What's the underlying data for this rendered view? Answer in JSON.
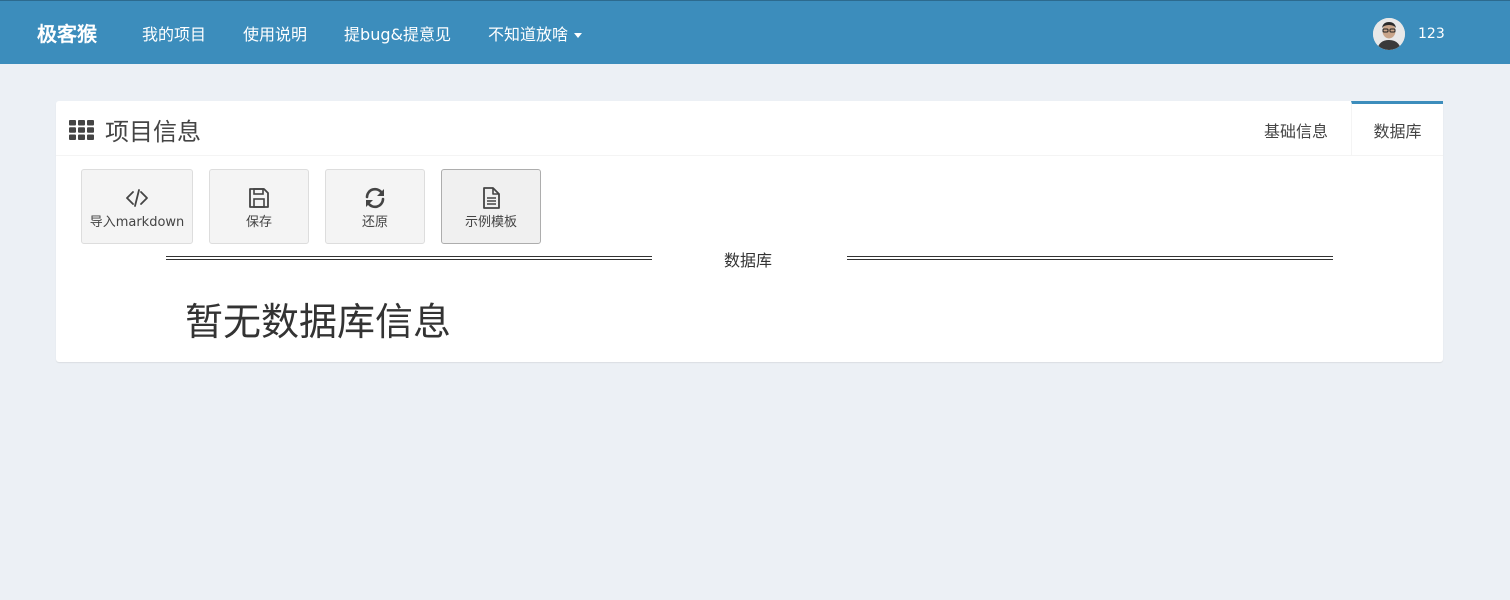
{
  "navbar": {
    "brand": "极客猴",
    "links": [
      {
        "label": "我的项目"
      },
      {
        "label": "使用说明"
      },
      {
        "label": "提bug&提意见"
      },
      {
        "label": "不知道放啥",
        "has_dropdown": true
      }
    ],
    "user": {
      "name": "123"
    }
  },
  "panel": {
    "title": "项目信息",
    "title_icon": "th-grid-icon",
    "tabs": [
      {
        "label": "基础信息",
        "active": false
      },
      {
        "label": "数据库",
        "active": true
      }
    ],
    "toolbar": [
      {
        "label": "导入markdown",
        "icon": "code-icon"
      },
      {
        "label": "保存",
        "icon": "save-icon"
      },
      {
        "label": "还原",
        "icon": "refresh-icon"
      },
      {
        "label": "示例模板",
        "icon": "file-text-icon"
      }
    ],
    "section_title": "数据库",
    "empty_message": "暂无数据库信息"
  },
  "colors": {
    "navbar_bg": "#3c8dbc",
    "page_bg": "#ecf0f5",
    "accent": "#3c8dbc"
  }
}
